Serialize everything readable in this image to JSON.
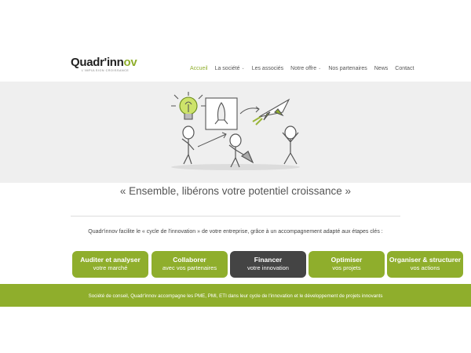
{
  "colors": {
    "accent": "#8fae2c",
    "dark_button": "#444444",
    "hero_bg": "#efefef"
  },
  "logo": {
    "name_dark": "Quadr'inn",
    "name_green": "ov",
    "tagline": "L'IMPULSION CROISSANCE"
  },
  "nav": {
    "items": [
      {
        "label": "Accueil",
        "active": true,
        "dropdown": false
      },
      {
        "label": "La société",
        "active": false,
        "dropdown": true
      },
      {
        "label": "Les associés",
        "active": false,
        "dropdown": false
      },
      {
        "label": "Notre offre",
        "active": false,
        "dropdown": true
      },
      {
        "label": "Nos partenaires",
        "active": false,
        "dropdown": false
      },
      {
        "label": "News",
        "active": false,
        "dropdown": false
      },
      {
        "label": "Contact",
        "active": false,
        "dropdown": false
      }
    ],
    "chevron": "⌄"
  },
  "hero": {
    "illustration": "innovation-cycle-sketch"
  },
  "tagline": "« Ensemble, libérons votre potentiel croissance »",
  "intro": "Quadr'innov facilite le « cycle de l'innovation » de votre entreprise, grâce à un accompagnement adapté aux étapes clés :",
  "steps": [
    {
      "title": "Auditer et analyser",
      "subtitle": "votre marché"
    },
    {
      "title": "Collaborer",
      "subtitle": "avec vos partenaires"
    },
    {
      "title": "Financer",
      "subtitle": "votre innovation"
    },
    {
      "title": "Optimiser",
      "subtitle": "vos projets"
    },
    {
      "title": "Organiser & structurer",
      "subtitle": "vos actions"
    }
  ],
  "footer": "Société de conseil, Quadr'innov accompagne les PME, PMI, ETI dans leur cycle de l'innovation et le développement de projets innovants"
}
